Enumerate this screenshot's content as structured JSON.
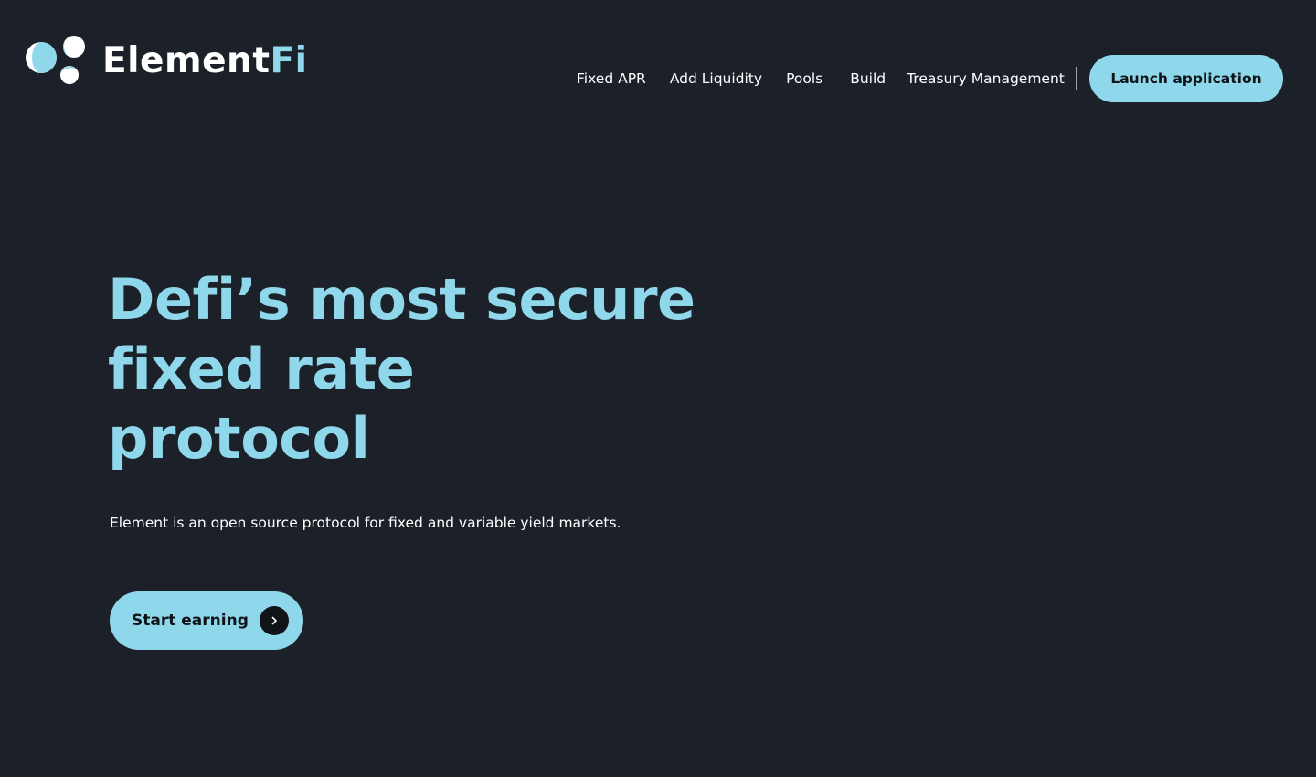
{
  "brand": {
    "name_part1": "Element",
    "name_part2": "Fi",
    "logo_icon": "element-circles-logo"
  },
  "nav": {
    "items": [
      {
        "label": "Fixed APR"
      },
      {
        "label": "Add Liquidity"
      },
      {
        "label": "Pools"
      },
      {
        "label": "Build"
      },
      {
        "label": "Treasury Management"
      }
    ],
    "launch_label": "Launch application"
  },
  "hero": {
    "title_lines": [
      "Defi’s most secure",
      "fixed rate",
      "protocol"
    ],
    "subtitle": "Element is an open source protocol for fixed and variable yield markets.",
    "cta_label": "Start earning",
    "cta_icon": "chevron-right-icon"
  },
  "colors": {
    "background": "#1c2129",
    "accent": "#8fd7ea",
    "text": "#ffffff",
    "button_text": "#0f1419"
  }
}
